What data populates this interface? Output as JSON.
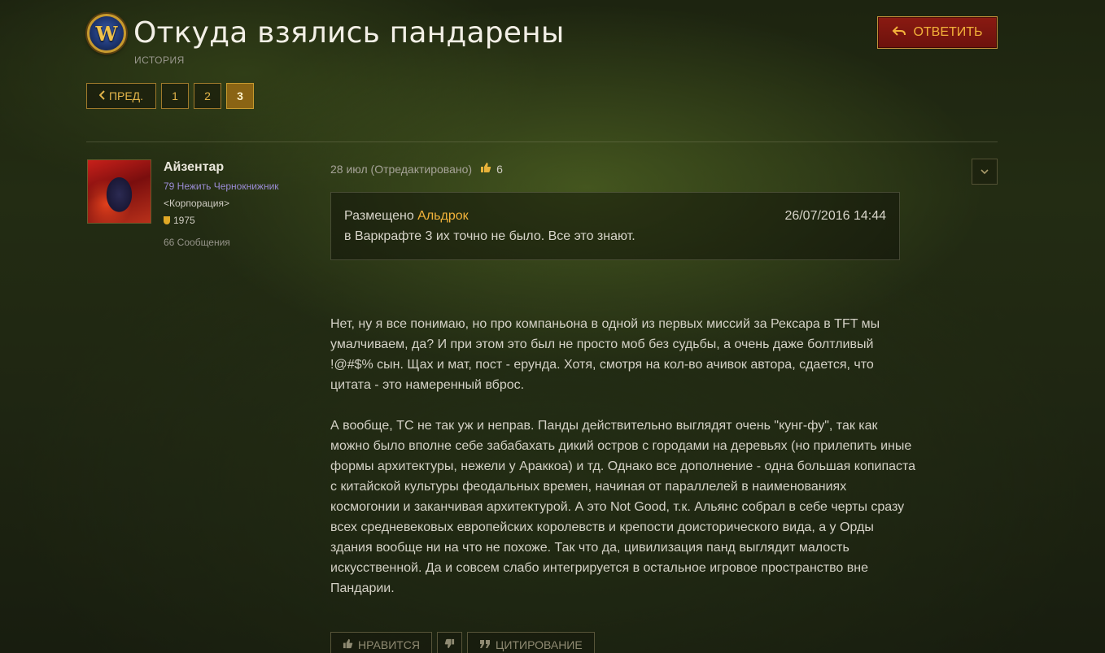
{
  "header": {
    "logo_letter": "W",
    "title": "Откуда взялись пандарены",
    "category": "ИСТОРИЯ",
    "reply_icon": "reply-icon",
    "reply_label": "ОТВЕТИТЬ",
    "accent": "#f3b23a"
  },
  "pagination": {
    "prev_icon": "chevron-left-icon",
    "prev_label": "ПРЕД.",
    "pages": [
      "1",
      "2",
      "3"
    ],
    "current": "3"
  },
  "author": {
    "name": "Айзентар",
    "class_line": "79 Нежить Чернокнижник",
    "guild": "<Корпорация>",
    "achievement_points": "1975",
    "posts": "66 Сообщения",
    "class_color": "#9b8cd6"
  },
  "post": {
    "date": "28 июл (Отредактировано)",
    "likes": "6",
    "like_icon": "thumbs-up-icon",
    "menu_icon": "chevron-down-icon",
    "quote": {
      "prefix": "Размещено",
      "author": "Альдрок",
      "date": "26/07/2016 14:44",
      "text": "в Варкрафте 3 их точно не было. Все это знают."
    },
    "paragraphs": [
      "Нет, ну я все понимаю, но про компаньона в одной из первых миссий за Рексара в TFT мы умалчиваем, да? И при этом это был не просто моб без судьбы, а очень даже болтливый !@#$% сын. Щах и мат, пост - ерунда. Хотя, смотря на кол-во ачивок автора, сдается, что цитата - это намеренный вброс.",
      "А вообще, ТС не так уж и неправ. Панды действительно выглядят очень \"кунг-фу\", так как можно было вполне себе забабахать дикий остров с городами на деревьях (но прилепить иные формы архитектуры, нежели у Араккоа) и тд. Однако все дополнение - одна большая копипаста с китайской культуры феодальных времен, начиная от параллелей в наименованиях космогонии и заканчивая архитектурой. А это Not Good, т.к. Альянс собрал в себе черты сразу всех средневековых европейских королевств и крепости доисторического вида, а у Орды здания вообще ни на что не похоже. Так что да, цивилизация панд выглядит малость искусственной. Да и совсем слабо интегрируется в остальное игровое пространство вне Пандарии."
    ],
    "actions": {
      "like_label": "НРАВИТСЯ",
      "dislike_icon": "thumbs-down-icon",
      "quote_icon": "quote-icon",
      "quote_label": "ЦИТИРОВАНИЕ"
    }
  }
}
